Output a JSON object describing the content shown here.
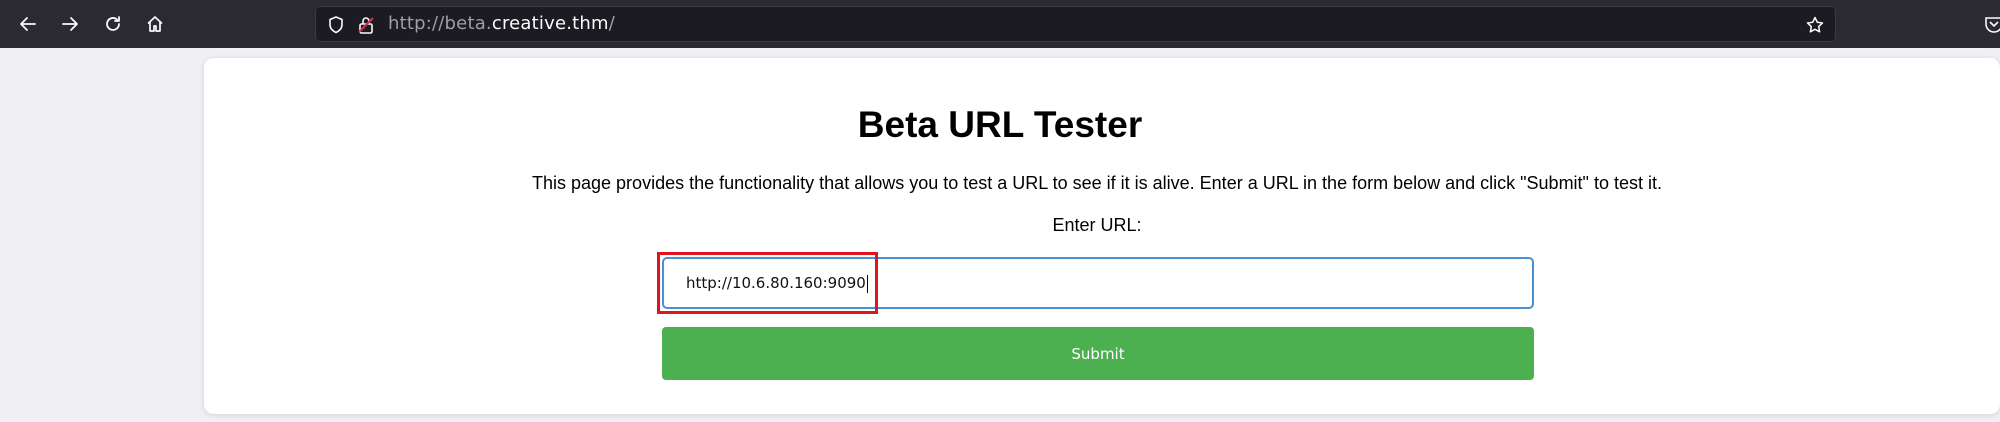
{
  "browser": {
    "url_scheme": "http://beta.",
    "url_host": "creative.thm",
    "url_path": "/"
  },
  "page": {
    "title": "Beta URL Tester",
    "description": "This page provides the functionality that allows you to test a URL to see if it is alive. Enter a URL in the form below and click \"Submit\" to test it.",
    "url_label": "Enter URL:",
    "url_input_value": "http://10.6.80.160:9090",
    "submit_label": "Submit"
  },
  "colors": {
    "toolbar": "#2b2a33",
    "submit": "#4caf50",
    "input_border": "#4a90d9",
    "highlight": "#e0141e"
  }
}
